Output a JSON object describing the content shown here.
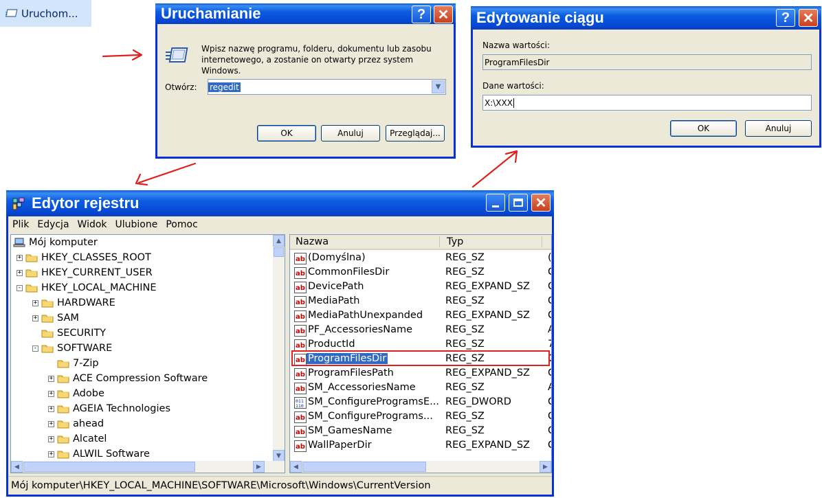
{
  "start_menu": {
    "run_label": "Uruchom..."
  },
  "run_dialog": {
    "title": "Uruchamianie",
    "description": "Wpisz nazwę programu, folderu, dokumentu lub zasobu internetowego, a zostanie on otwarty przez system Windows.",
    "open_label": "Otwórz:",
    "open_value": "regedit",
    "ok": "OK",
    "cancel": "Anuluj",
    "browse": "Przeglądaj..."
  },
  "edit_dialog": {
    "title": "Edytowanie ciągu",
    "name_label": "Nazwa wartości:",
    "name_value": "ProgramFilesDir",
    "data_label": "Dane wartości:",
    "data_value": "X:\\XXX",
    "ok": "OK",
    "cancel": "Anuluj"
  },
  "regedit": {
    "title": "Edytor rejestru",
    "menu": [
      "Plik",
      "Edycja",
      "Widok",
      "Ulubione",
      "Pomoc"
    ],
    "tree": [
      {
        "label": "Mój komputer",
        "level": 0,
        "icon": "computer-icon",
        "exp": ""
      },
      {
        "label": "HKEY_CLASSES_ROOT",
        "level": 1,
        "icon": "folder-icon",
        "exp": "+"
      },
      {
        "label": "HKEY_CURRENT_USER",
        "level": 1,
        "icon": "folder-icon",
        "exp": "+"
      },
      {
        "label": "HKEY_LOCAL_MACHINE",
        "level": 1,
        "icon": "folder-icon",
        "exp": "-"
      },
      {
        "label": "HARDWARE",
        "level": 2,
        "icon": "folder-icon",
        "exp": "+"
      },
      {
        "label": "SAM",
        "level": 2,
        "icon": "folder-icon",
        "exp": "+"
      },
      {
        "label": "SECURITY",
        "level": 2,
        "icon": "folder-icon",
        "exp": ""
      },
      {
        "label": "SOFTWARE",
        "level": 2,
        "icon": "folder-icon",
        "exp": "-"
      },
      {
        "label": "7-Zip",
        "level": 3,
        "icon": "folder-icon",
        "exp": ""
      },
      {
        "label": "ACE Compression Software",
        "level": 3,
        "icon": "folder-icon",
        "exp": "+"
      },
      {
        "label": "Adobe",
        "level": 3,
        "icon": "folder-icon",
        "exp": "+"
      },
      {
        "label": "AGEIA Technologies",
        "level": 3,
        "icon": "folder-icon",
        "exp": "+"
      },
      {
        "label": "ahead",
        "level": 3,
        "icon": "folder-icon",
        "exp": "+"
      },
      {
        "label": "Alcatel",
        "level": 3,
        "icon": "folder-icon",
        "exp": "+"
      },
      {
        "label": "ALWIL Software",
        "level": 3,
        "icon": "folder-icon",
        "exp": "+"
      }
    ],
    "columns": {
      "name": "Nazwa",
      "type": "Typ"
    },
    "values": [
      {
        "name": "(Domyślna)",
        "type": "REG_SZ",
        "data": "(",
        "icon": "string-value-icon"
      },
      {
        "name": "CommonFilesDir",
        "type": "REG_SZ",
        "data": "C",
        "icon": "string-value-icon"
      },
      {
        "name": "DevicePath",
        "type": "REG_EXPAND_SZ",
        "data": "C",
        "icon": "string-value-icon"
      },
      {
        "name": "MediaPath",
        "type": "REG_SZ",
        "data": "C",
        "icon": "string-value-icon"
      },
      {
        "name": "MediaPathUnexpanded",
        "type": "REG_EXPAND_SZ",
        "data": "C",
        "icon": "string-value-icon"
      },
      {
        "name": "PF_AccessoriesName",
        "type": "REG_SZ",
        "data": "A",
        "icon": "string-value-icon"
      },
      {
        "name": "ProductId",
        "type": "REG_SZ",
        "data": "7",
        "icon": "string-value-icon"
      },
      {
        "name": "ProgramFilesDir",
        "type": "REG_SZ",
        "data": "C",
        "icon": "string-value-icon",
        "selected": true
      },
      {
        "name": "ProgramFilesPath",
        "type": "REG_EXPAND_SZ",
        "data": "C",
        "icon": "string-value-icon"
      },
      {
        "name": "SM_AccessoriesName",
        "type": "REG_SZ",
        "data": "A",
        "icon": "string-value-icon"
      },
      {
        "name": "SM_ConfigureProgramsE...",
        "type": "REG_DWORD",
        "data": "C",
        "icon": "dword-value-icon"
      },
      {
        "name": "SM_ConfigurePrograms...",
        "type": "REG_SZ",
        "data": "C",
        "icon": "string-value-icon"
      },
      {
        "name": "SM_GamesName",
        "type": "REG_SZ",
        "data": "C",
        "icon": "string-value-icon"
      },
      {
        "name": "WallPaperDir",
        "type": "REG_EXPAND_SZ",
        "data": "C",
        "icon": "string-value-icon"
      }
    ],
    "status": "Mój komputer\\HKEY_LOCAL_MACHINE\\SOFTWARE\\Microsoft\\Windows\\CurrentVersion"
  },
  "colors": {
    "xp_blue": "#0a5fdb",
    "annotation_red": "#e0201c",
    "selection": "#316ac5",
    "close_red": "#d6532c"
  }
}
